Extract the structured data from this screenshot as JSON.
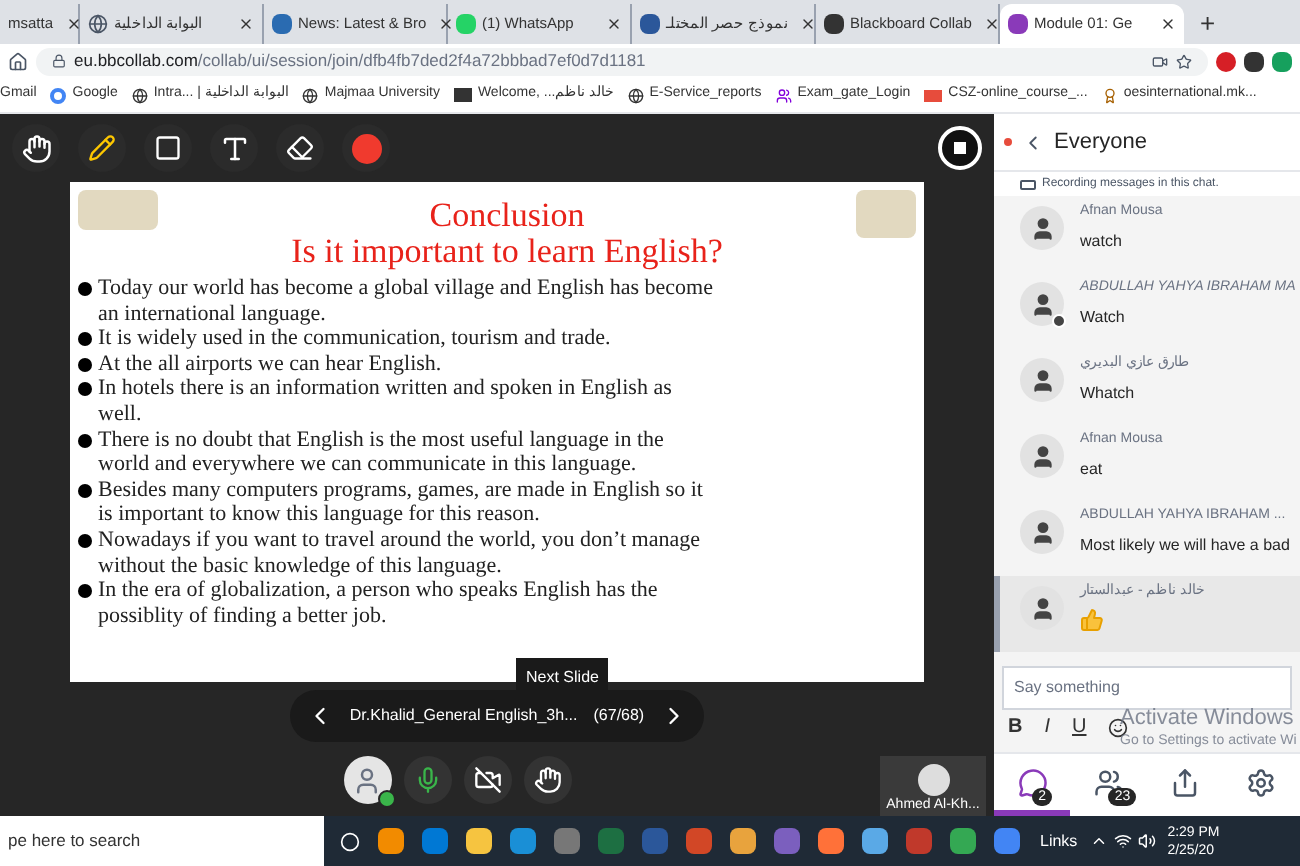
{
  "browser": {
    "tabs": [
      {
        "title": "msatta",
        "selected": false
      },
      {
        "title": "البوابة الداخلية",
        "selected": false
      },
      {
        "title": "News: Latest & Bro",
        "selected": false
      },
      {
        "title": "(1) WhatsApp",
        "selected": false
      },
      {
        "title": "نموذج حصر المختلـ",
        "selected": false
      },
      {
        "title": "Blackboard Collab",
        "selected": false
      },
      {
        "title": "Module 01: Ge",
        "selected": true
      }
    ],
    "new_tab": "+",
    "address": {
      "host": "eu.bbcollab.com",
      "path": "/collab/ui/session/join/dfb4fb7ded2f4a72bbbad7ef0d7d1181"
    },
    "bookmarks": [
      "Gmail",
      "Google",
      "Intra... | البوابة الداخلية",
      "Majmaa University",
      "Welcome, ...خالد ناظم",
      "E-Service_reports",
      "Exam_gate_Login",
      "CSZ-online_course_...",
      "oesinternational.mk..."
    ]
  },
  "toolbar": {
    "tools": [
      {
        "kind": "hand"
      },
      {
        "kind": "pencil"
      },
      {
        "kind": "rectangle"
      },
      {
        "kind": "text"
      },
      {
        "kind": "eraser"
      },
      {
        "kind": "color",
        "color": "#f03a2e"
      }
    ]
  },
  "slide": {
    "title": "Conclusion",
    "subtitle": "Is it important to learn English?",
    "bullets": [
      "Today our world has become a global village and English has become an international language.",
      "It is widely used in the communication, tourism and trade.",
      "At the all airports we can hear English.",
      "In hotels there is an information written and spoken in English as well.",
      "There is no doubt that English is the most useful language in the world and everywhere we can communicate in this language.",
      "Besides many computers programs, games, are made in English so it is important to know this language for this reason.",
      "Nowadays if you want to travel around the world, you don’t manage without the basic knowledge of this language.",
      "In the era of globalization,  a person who speaks English has the possiblity of finding a better job."
    ],
    "tooltip": "Next Slide",
    "file_name": "Dr.Khalid_General English_3h...",
    "counter": "(67/68)"
  },
  "session_controls": {
    "mic_on": true,
    "camera_on": false
  },
  "video_tile": {
    "name": "Ahmed Al-Kh..."
  },
  "chat": {
    "title": "Everyone",
    "recording_notice": "Recording messages in this chat.",
    "messages": [
      {
        "author": "Afnan Mousa",
        "kind": "text",
        "text": "watch",
        "moderator": false,
        "selected": false
      },
      {
        "author": "ABDULLAH YAHYA IBRAHAM MA",
        "kind": "text",
        "text": "Watch",
        "moderator": true,
        "selected": false
      },
      {
        "author": "طارق عازي البديري",
        "kind": "text",
        "text": "Whatch",
        "moderator": false,
        "selected": false
      },
      {
        "author": "Afnan Mousa",
        "kind": "text",
        "text": "eat",
        "moderator": false,
        "selected": false
      },
      {
        "author": "ABDULLAH YAHYA IBRAHAM ...",
        "kind": "text",
        "text": "Most likely we will have a bad",
        "moderator": false,
        "selected": false
      },
      {
        "author": "خالد ناظم - عبدالستار",
        "kind": "reaction",
        "moderator": false,
        "selected": true
      }
    ],
    "placeholder": "Say something",
    "format_buttons": [
      {
        "label": "B",
        "kind": "bold"
      },
      {
        "label": "I",
        "kind": "italic"
      },
      {
        "label": "U",
        "kind": "underline"
      },
      {
        "kind": "emoji"
      }
    ],
    "panel_tabs": [
      {
        "kind": "chat",
        "badge": "2",
        "selected": true
      },
      {
        "kind": "participants",
        "badge": "23",
        "selected": false
      },
      {
        "kind": "share",
        "selected": false
      },
      {
        "kind": "settings",
        "selected": false
      }
    ]
  },
  "activation": {
    "title": "Activate Windows",
    "hint": "Go to Settings to activate Wi"
  },
  "taskbar": {
    "search": "pe here to search",
    "links": "Links",
    "time": "2:29 PM",
    "date": "2/25/20"
  }
}
